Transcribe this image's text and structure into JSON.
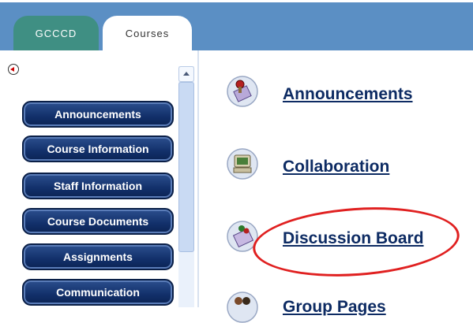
{
  "tabs": [
    {
      "label": "GCCCD",
      "active": false
    },
    {
      "label": "Courses",
      "active": true
    }
  ],
  "menu": {
    "items": [
      {
        "label": "Announcements"
      },
      {
        "label": "Course Information"
      },
      {
        "label": "Staff Information"
      },
      {
        "label": "Course Documents"
      },
      {
        "label": "Assignments"
      },
      {
        "label": "Communication"
      }
    ]
  },
  "tools": [
    {
      "label": "Announcements",
      "icon": "announcements-icon"
    },
    {
      "label": "Collaboration",
      "icon": "collaboration-icon"
    },
    {
      "label": "Discussion Board",
      "icon": "discussion-board-icon",
      "highlighted": true
    },
    {
      "label": "Group Pages",
      "icon": "group-pages-icon"
    }
  ],
  "colors": {
    "tab_bar": "#5b8fc4",
    "tab_gcccd": "#3f8f83",
    "menu_button": "#12306a",
    "link": "#0d2b63",
    "highlight": "#e02020"
  }
}
